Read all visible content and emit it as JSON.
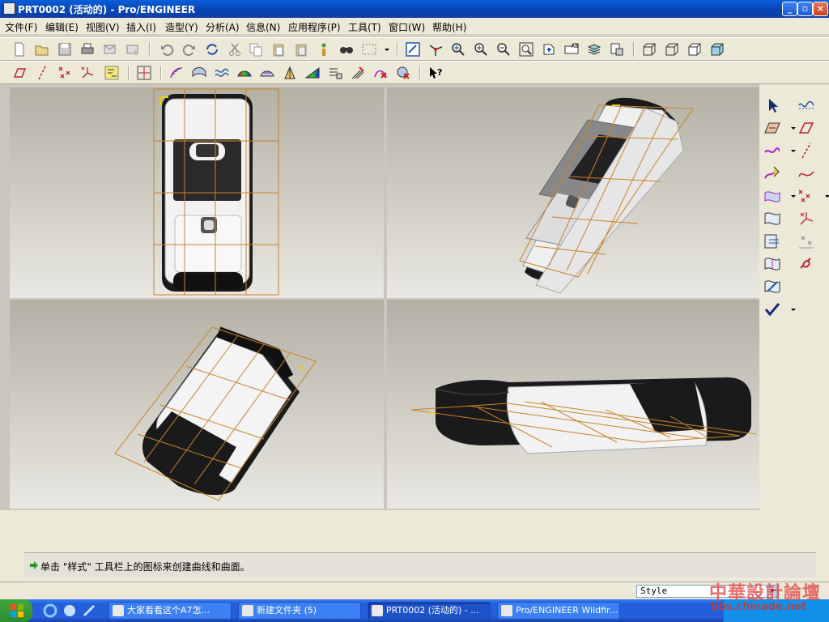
{
  "window": {
    "title": "PRT0002 (活动的) - Pro/ENGINEER",
    "controls": [
      "minimize",
      "maximize",
      "close"
    ]
  },
  "menu": [
    "文件(F)",
    "编辑(E)",
    "视图(V)",
    "插入(I)",
    "造型(Y)",
    "分析(A)",
    "信息(N)",
    "应用程序(P)",
    "工具(T)",
    "窗口(W)",
    "帮助(H)"
  ],
  "toolbar1_icons": [
    "new-file-icon",
    "open-file-icon",
    "save-icon",
    "print-icon",
    "email-icon",
    "email-attach-icon",
    "undo-icon",
    "redo-icon",
    "regenerate-icon",
    "cut-icon",
    "copy-icon",
    "paste-icon",
    "paste-special-icon",
    "model-tree-icon",
    "find-icon",
    "select-box-icon",
    "dropdown-icon",
    "repaint-icon",
    "spin-center-icon",
    "orient-icon",
    "zoom-in-icon",
    "zoom-out-icon",
    "refit-icon",
    "saved-views-icon",
    "layers-icon",
    "view-manager-icon",
    "wireframe-icon",
    "hidden-line-icon",
    "no-hidden-icon",
    "shading-icon"
  ],
  "toolbar2_icons": [
    "datum-planes-icon",
    "datum-axes-icon",
    "datum-points-icon",
    "coord-systems-icon",
    "annotations-icon",
    "grid-snap-icon",
    "curvature-icon",
    "section-icon",
    "offset-icon",
    "reflection-icon",
    "slope-icon",
    "draft-icon",
    "dihedral-icon",
    "curve-analysis-icon",
    "surface-analysis-icon",
    "delete-analysis-icon",
    "hide-analysis-icon",
    "whats-this-icon"
  ],
  "style_tools_icons": [
    "select-arrow-icon",
    "plane-curve-icon",
    "style-plane-icon",
    "plane-icon",
    "curve-icon",
    "axis-icon",
    "edit-curve-icon",
    "spline-icon",
    "surface-icon",
    "point-icon",
    "surface-edit-icon",
    "coordinate-point-icon",
    "surface-trim-icon",
    "offset-point-icon",
    "project-icon",
    "connect-icon",
    "boundary-icon",
    "done-check-icon"
  ],
  "message": "单击 \"样式\" 工具栏上的图标来创建曲线和曲面。",
  "status": {
    "style_filter": "Style"
  },
  "taskbar": {
    "buttons": [
      {
        "label": "大家看看这个A7怎...",
        "active": false
      },
      {
        "label": "新建文件夹 (5)",
        "active": false
      },
      {
        "label": "PRT0002 (活动的) - ...",
        "active": true
      },
      {
        "label": "Pro/ENGINEER Wildfir...",
        "active": false
      }
    ]
  },
  "watermark": {
    "line1": "中華設計論壇",
    "line2": "bbs.chinade.net"
  },
  "colors": {
    "titlebar": "#0846b8",
    "viewport_bg_top": "#b3b0a4",
    "viewport_bg_bottom": "#e9e8e2",
    "wireframe": "#d08a2a",
    "phone_dark": "#1a1a1a"
  }
}
